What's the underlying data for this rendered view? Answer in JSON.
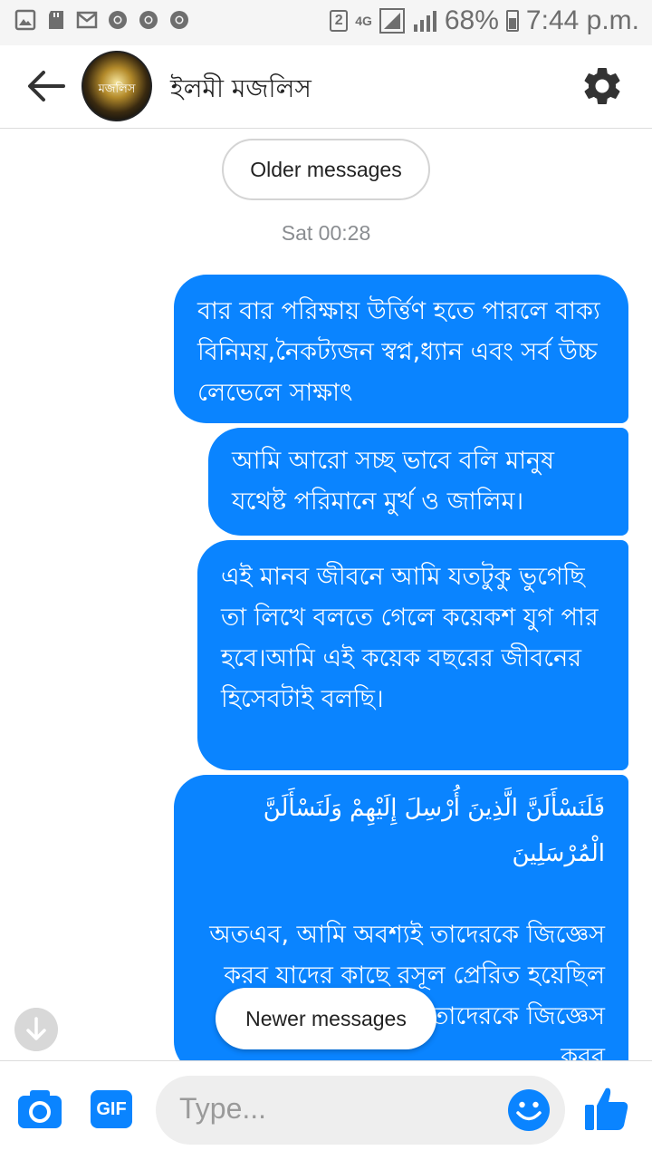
{
  "status_bar": {
    "sim_slot": "2",
    "network": "4G",
    "battery": "68%",
    "time": "7:44 p.m."
  },
  "header": {
    "title": "ইলমী মজলিস",
    "avatar_text": "মজলিস"
  },
  "chat": {
    "older_label": "Older messages",
    "timestamp": "Sat 00:28",
    "messages": [
      {
        "text": "বার বার পরিক্ষায় উর্ত্তিণ হতে পারলে বাক্য বিনিময়,নৈকট্যজন স্বপ্ন,ধ্যান এবং সর্ব উচ্চ লেভেলে সাক্ষাৎ"
      },
      {
        "text": "আমি আরো সচ্ছ ভাবে বলি মানুষ যথেষ্ট পরিমানে মুর্খ ও জালিম।"
      },
      {
        "text": "এই মানব জীবনে আমি যতটুকু ভুগেছি তা লিখে বলতে গেলে কয়েকশ যুগ পার হবে।আমি এই কয়েক বছরের জীবনের হিসেবটাই বলছি।"
      },
      {
        "arabic": "فَلَنَسْأَلَنَّ الَّذِينَ أُرْسِلَ إِلَيْهِمْ وَلَنَسْأَلَنَّ الْمُرْسَلِينَ",
        "text": "অতএব, আমি অবশ্যই তাদেরকে জিজ্ঞেস করব যাদের কাছে রসূল প্রেরিত হয়েছিল এবং আমি অবশ্যই তাদেরকে জিজ্ঞেস করব"
      }
    ],
    "newer_label": "Newer messages"
  },
  "composer": {
    "gif_label": "GIF",
    "placeholder": "Type..."
  },
  "colors": {
    "bubble": "#0a84ff",
    "accent": "#0a84ff"
  }
}
